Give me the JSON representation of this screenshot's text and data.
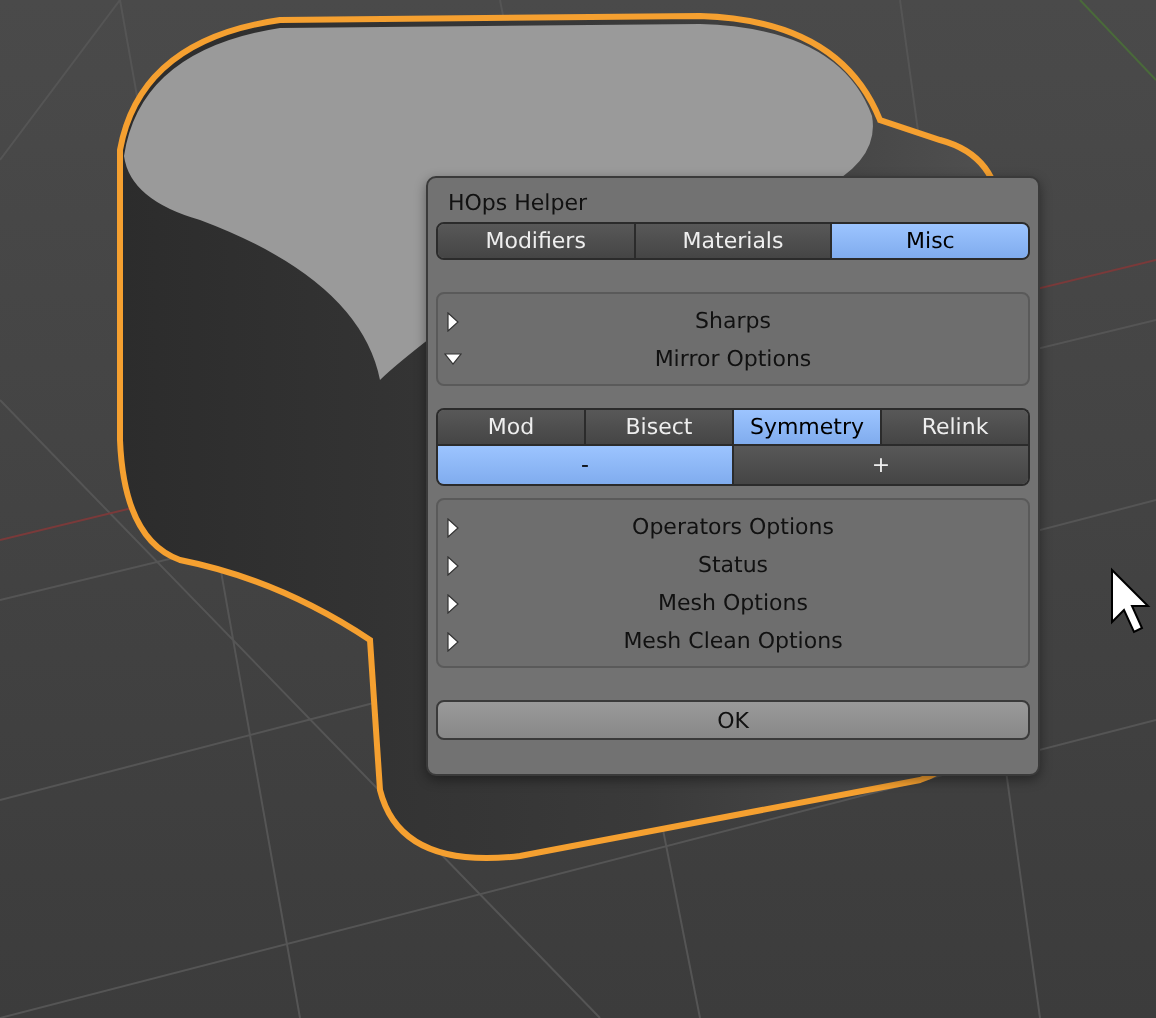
{
  "dialog": {
    "title": "HOps Helper",
    "tabs": [
      {
        "label": "Modifiers",
        "selected": false
      },
      {
        "label": "Materials",
        "selected": false
      },
      {
        "label": "Misc",
        "selected": true
      }
    ],
    "top_panel": {
      "items": [
        {
          "label": "Sharps",
          "expanded": false
        },
        {
          "label": "Mirror Options",
          "expanded": true
        }
      ]
    },
    "mirror_tabs": [
      {
        "label": "Mod",
        "selected": false
      },
      {
        "label": "Bisect",
        "selected": false
      },
      {
        "label": "Symmetry",
        "selected": true
      },
      {
        "label": "Relink",
        "selected": false
      }
    ],
    "direction_buttons": [
      {
        "label": "-",
        "selected": true
      },
      {
        "label": "+",
        "selected": false
      }
    ],
    "options_panel": {
      "items": [
        {
          "label": "Operators Options",
          "expanded": false
        },
        {
          "label": "Status",
          "expanded": false
        },
        {
          "label": "Mesh Options",
          "expanded": false
        },
        {
          "label": "Mesh Clean Options",
          "expanded": false
        }
      ]
    },
    "ok_button": "OK"
  }
}
